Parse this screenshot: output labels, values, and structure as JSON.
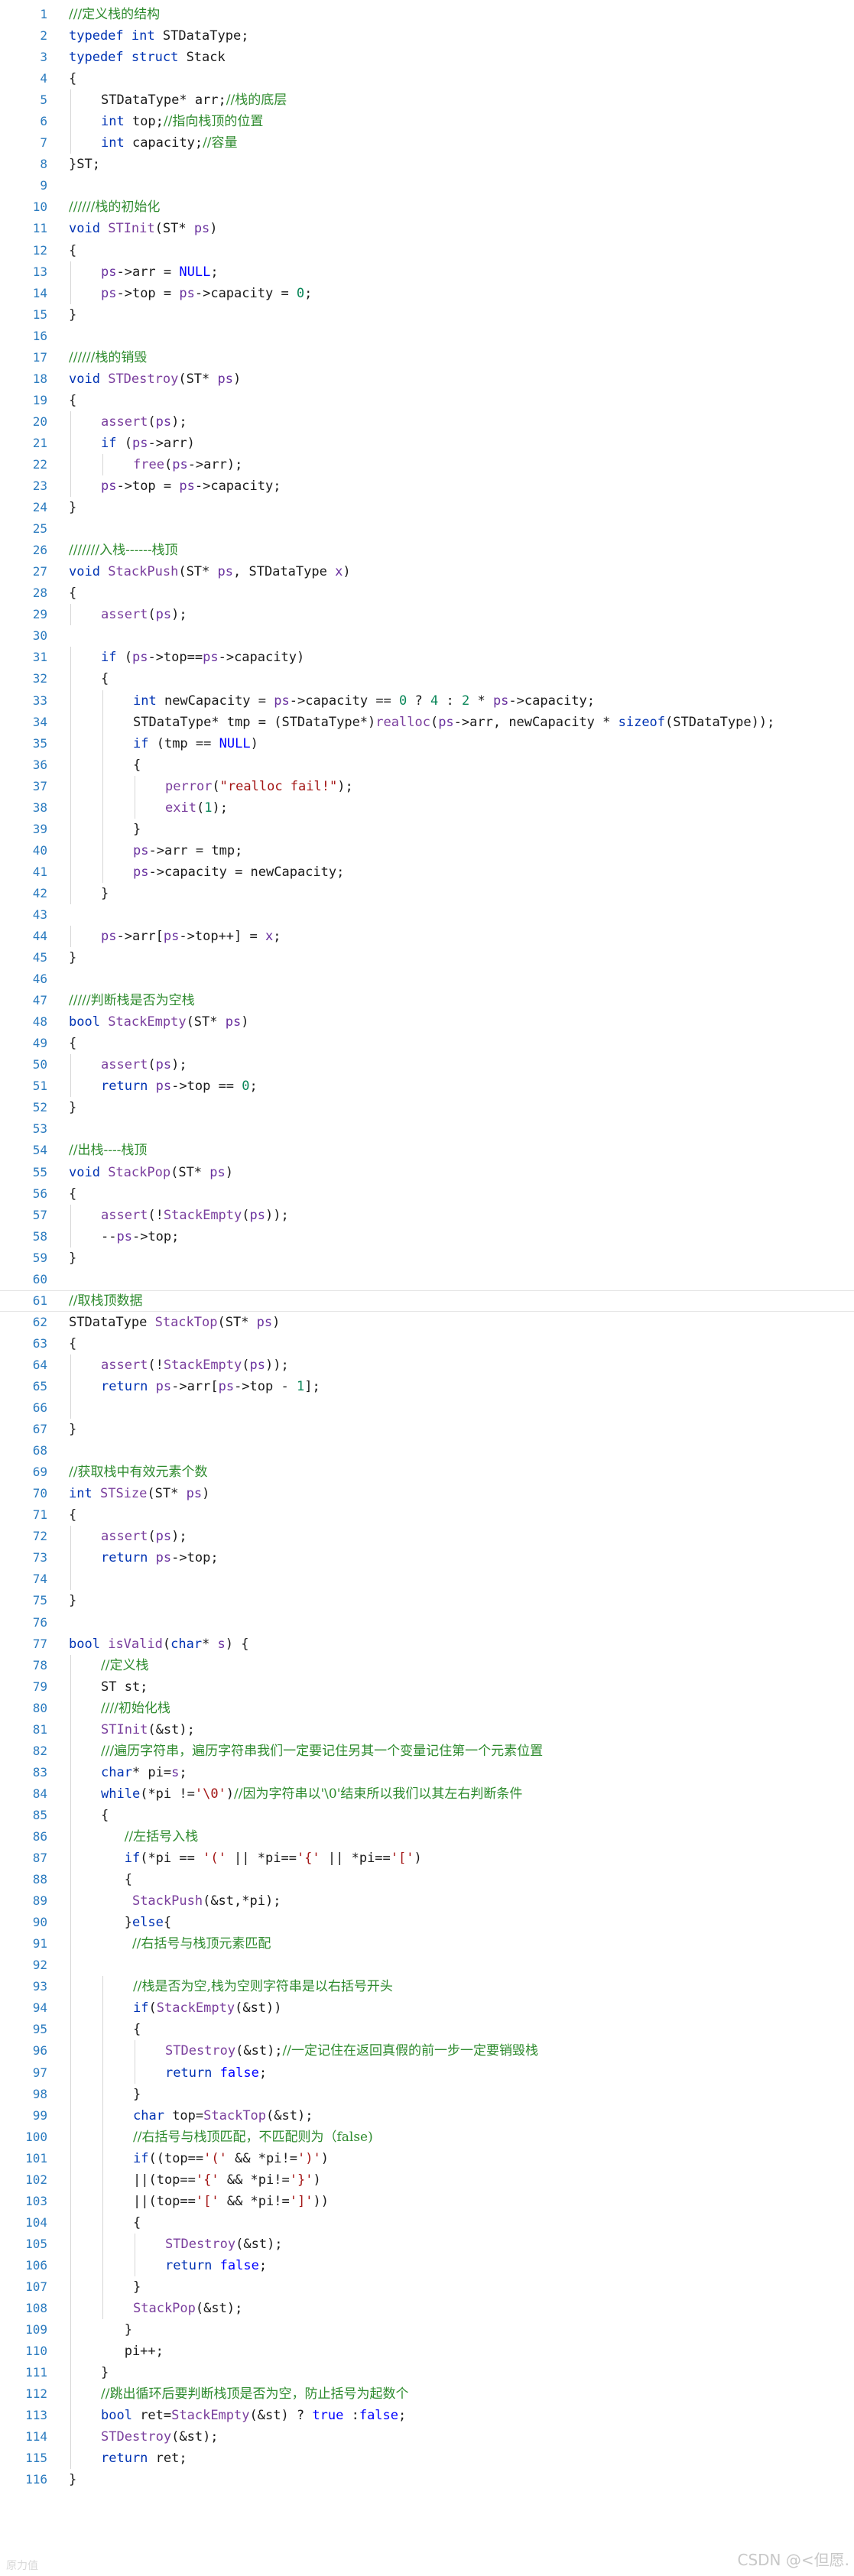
{
  "editor": {
    "highlighted_line": 61,
    "indent_guide_color": "#d6d6d6",
    "colors": {
      "line_number": "#2b7bbf",
      "keyword": "#0033b3",
      "comment": "#2e8b2e",
      "function": "#7a3e9d",
      "string": "#a31515",
      "number": "#098658"
    },
    "lines": [
      {
        "n": "1",
        "indent": 0,
        "text": "///定义栈的结构"
      },
      {
        "n": "2",
        "indent": 0,
        "text": "typedef int STDataType;"
      },
      {
        "n": "3",
        "indent": 0,
        "text": "typedef struct Stack"
      },
      {
        "n": "4",
        "indent": 0,
        "text": "{"
      },
      {
        "n": "5",
        "indent": 1,
        "text": "STDataType* arr;//栈的底层"
      },
      {
        "n": "6",
        "indent": 1,
        "text": "int top;//指向栈顶的位置"
      },
      {
        "n": "7",
        "indent": 1,
        "text": "int capacity;//容量"
      },
      {
        "n": "8",
        "indent": 0,
        "text": "}ST;"
      },
      {
        "n": "9",
        "indent": 0,
        "text": ""
      },
      {
        "n": "10",
        "indent": 0,
        "text": "//////栈的初始化"
      },
      {
        "n": "11",
        "indent": 0,
        "text": "void STInit(ST* ps)"
      },
      {
        "n": "12",
        "indent": 0,
        "text": "{"
      },
      {
        "n": "13",
        "indent": 1,
        "text": "ps->arr = NULL;"
      },
      {
        "n": "14",
        "indent": 1,
        "text": "ps->top = ps->capacity = 0;"
      },
      {
        "n": "15",
        "indent": 0,
        "text": "}"
      },
      {
        "n": "16",
        "indent": 0,
        "text": ""
      },
      {
        "n": "17",
        "indent": 0,
        "text": "//////栈的销毁"
      },
      {
        "n": "18",
        "indent": 0,
        "text": "void STDestroy(ST* ps)"
      },
      {
        "n": "19",
        "indent": 0,
        "text": "{"
      },
      {
        "n": "20",
        "indent": 1,
        "text": "assert(ps);"
      },
      {
        "n": "21",
        "indent": 1,
        "text": "if (ps->arr)"
      },
      {
        "n": "22",
        "indent": 2,
        "text": "free(ps->arr);"
      },
      {
        "n": "23",
        "indent": 1,
        "text": "ps->top = ps->capacity;"
      },
      {
        "n": "24",
        "indent": 0,
        "text": "}"
      },
      {
        "n": "25",
        "indent": 0,
        "text": ""
      },
      {
        "n": "26",
        "indent": 0,
        "text": "///////入栈------栈顶"
      },
      {
        "n": "27",
        "indent": 0,
        "text": "void StackPush(ST* ps, STDataType x)"
      },
      {
        "n": "28",
        "indent": 0,
        "text": "{"
      },
      {
        "n": "29",
        "indent": 1,
        "text": "assert(ps);"
      },
      {
        "n": "30",
        "indent": 0,
        "text": ""
      },
      {
        "n": "31",
        "indent": 1,
        "text": "if (ps->top==ps->capacity)"
      },
      {
        "n": "32",
        "indent": 1,
        "text": "{"
      },
      {
        "n": "33",
        "indent": 2,
        "text": "int newCapacity = ps->capacity == 0 ? 4 : 2 * ps->capacity;"
      },
      {
        "n": "34",
        "indent": 2,
        "text": "STDataType* tmp = (STDataType*)realloc(ps->arr, newCapacity * sizeof(STDataType));"
      },
      {
        "n": "35",
        "indent": 2,
        "text": "if (tmp == NULL)"
      },
      {
        "n": "36",
        "indent": 2,
        "text": "{"
      },
      {
        "n": "37",
        "indent": 3,
        "text": "perror(\"realloc fail!\");"
      },
      {
        "n": "38",
        "indent": 3,
        "text": "exit(1);"
      },
      {
        "n": "39",
        "indent": 2,
        "text": "}"
      },
      {
        "n": "40",
        "indent": 2,
        "text": "ps->arr = tmp;"
      },
      {
        "n": "41",
        "indent": 2,
        "text": "ps->capacity = newCapacity;"
      },
      {
        "n": "42",
        "indent": 1,
        "text": "}"
      },
      {
        "n": "43",
        "indent": 0,
        "text": ""
      },
      {
        "n": "44",
        "indent": 1,
        "text": "ps->arr[ps->top++] = x;"
      },
      {
        "n": "45",
        "indent": 0,
        "text": "}"
      },
      {
        "n": "46",
        "indent": 0,
        "text": ""
      },
      {
        "n": "47",
        "indent": 0,
        "text": "/////判断栈是否为空栈"
      },
      {
        "n": "48",
        "indent": 0,
        "text": "bool StackEmpty(ST* ps)"
      },
      {
        "n": "49",
        "indent": 0,
        "text": "{"
      },
      {
        "n": "50",
        "indent": 1,
        "text": "assert(ps);"
      },
      {
        "n": "51",
        "indent": 1,
        "text": "return ps->top == 0;"
      },
      {
        "n": "52",
        "indent": 0,
        "text": "}"
      },
      {
        "n": "53",
        "indent": 0,
        "text": ""
      },
      {
        "n": "54",
        "indent": 0,
        "text": "//出栈----栈顶"
      },
      {
        "n": "55",
        "indent": 0,
        "text": "void StackPop(ST* ps)"
      },
      {
        "n": "56",
        "indent": 0,
        "text": "{"
      },
      {
        "n": "57",
        "indent": 1,
        "text": "assert(!StackEmpty(ps));"
      },
      {
        "n": "58",
        "indent": 1,
        "text": "--ps->top;"
      },
      {
        "n": "59",
        "indent": 0,
        "text": "}"
      },
      {
        "n": "60",
        "indent": 0,
        "text": ""
      },
      {
        "n": "61",
        "indent": 0,
        "text": "//取栈顶数据"
      },
      {
        "n": "62",
        "indent": 0,
        "text": "STDataType StackTop(ST* ps)"
      },
      {
        "n": "63",
        "indent": 0,
        "text": "{"
      },
      {
        "n": "64",
        "indent": 1,
        "text": "assert(!StackEmpty(ps));"
      },
      {
        "n": "65",
        "indent": 1,
        "text": "return ps->arr[ps->top - 1];"
      },
      {
        "n": "66",
        "indent": 1,
        "text": ""
      },
      {
        "n": "67",
        "indent": 0,
        "text": "}"
      },
      {
        "n": "68",
        "indent": 0,
        "text": ""
      },
      {
        "n": "69",
        "indent": 0,
        "text": "//获取栈中有效元素个数"
      },
      {
        "n": "70",
        "indent": 0,
        "text": "int STSize(ST* ps)"
      },
      {
        "n": "71",
        "indent": 0,
        "text": "{"
      },
      {
        "n": "72",
        "indent": 1,
        "text": "assert(ps);"
      },
      {
        "n": "73",
        "indent": 1,
        "text": "return ps->top;"
      },
      {
        "n": "74",
        "indent": 1,
        "text": ""
      },
      {
        "n": "75",
        "indent": 0,
        "text": "}"
      },
      {
        "n": "76",
        "indent": 0,
        "text": ""
      },
      {
        "n": "77",
        "indent": 0,
        "text": "bool isValid(char* s) {"
      },
      {
        "n": "78",
        "indent": 1,
        "text": "//定义栈"
      },
      {
        "n": "79",
        "indent": 1,
        "text": "ST st;"
      },
      {
        "n": "80",
        "indent": 1,
        "text": "////初始化栈"
      },
      {
        "n": "81",
        "indent": 1,
        "text": "STInit(&st);"
      },
      {
        "n": "82",
        "indent": 1,
        "text": "///遍历字符串，遍历字符串我们一定要记住另其一个变量记住第一个元素位置"
      },
      {
        "n": "83",
        "indent": 1,
        "text": "char* pi=s;"
      },
      {
        "n": "84",
        "indent": 1,
        "text": "while(*pi !='\\0')//因为字符串以'\\0'结束所以我们以其左右判断条件"
      },
      {
        "n": "85",
        "indent": 1,
        "text": "{"
      },
      {
        "n": "86",
        "indent": 1,
        "text": "   //左括号入栈"
      },
      {
        "n": "87",
        "indent": 1,
        "text": "   if(*pi == '(' || *pi=='{' || *pi=='[')"
      },
      {
        "n": "88",
        "indent": 1,
        "text": "   {"
      },
      {
        "n": "89",
        "indent": 1,
        "text": "    StackPush(&st,*pi);"
      },
      {
        "n": "90",
        "indent": 1,
        "text": "   }else{"
      },
      {
        "n": "91",
        "indent": 1,
        "text": "    //右括号与栈顶元素匹配"
      },
      {
        "n": "92",
        "indent": 1,
        "text": ""
      },
      {
        "n": "93",
        "indent": 2,
        "text": "//栈是否为空,栈为空则字符串是以右括号开头"
      },
      {
        "n": "94",
        "indent": 2,
        "text": "if(StackEmpty(&st))"
      },
      {
        "n": "95",
        "indent": 2,
        "text": "{"
      },
      {
        "n": "96",
        "indent": 3,
        "text": "STDestroy(&st);//一定记住在返回真假的前一步一定要销毁栈"
      },
      {
        "n": "97",
        "indent": 3,
        "text": "return false;"
      },
      {
        "n": "98",
        "indent": 2,
        "text": "}"
      },
      {
        "n": "99",
        "indent": 2,
        "text": "char top=StackTop(&st);"
      },
      {
        "n": "100",
        "indent": 2,
        "text": "//右括号与栈顶匹配，不匹配则为（false)"
      },
      {
        "n": "101",
        "indent": 2,
        "text": "if((top=='(' && *pi!=')')"
      },
      {
        "n": "102",
        "indent": 2,
        "text": "||(top=='{' && *pi!='}')"
      },
      {
        "n": "103",
        "indent": 2,
        "text": "||(top=='[' && *pi!=']'))"
      },
      {
        "n": "104",
        "indent": 2,
        "text": "{"
      },
      {
        "n": "105",
        "indent": 3,
        "text": "STDestroy(&st);"
      },
      {
        "n": "106",
        "indent": 3,
        "text": "return false;"
      },
      {
        "n": "107",
        "indent": 2,
        "text": "}"
      },
      {
        "n": "108",
        "indent": 2,
        "text": "StackPop(&st);"
      },
      {
        "n": "109",
        "indent": 1,
        "text": "   }"
      },
      {
        "n": "110",
        "indent": 1,
        "text": "   pi++;"
      },
      {
        "n": "111",
        "indent": 1,
        "text": "}"
      },
      {
        "n": "112",
        "indent": 1,
        "text": "//跳出循环后要判断栈顶是否为空，防止括号为起数个"
      },
      {
        "n": "113",
        "indent": 1,
        "text": "bool ret=StackEmpty(&st) ? true :false;"
      },
      {
        "n": "114",
        "indent": 1,
        "text": "STDestroy(&st);"
      },
      {
        "n": "115",
        "indent": 1,
        "text": "return ret;"
      },
      {
        "n": "116",
        "indent": 0,
        "text": "}"
      }
    ]
  },
  "watermark": "CSDN @<但愿.",
  "bottom_stamp": "原力值"
}
